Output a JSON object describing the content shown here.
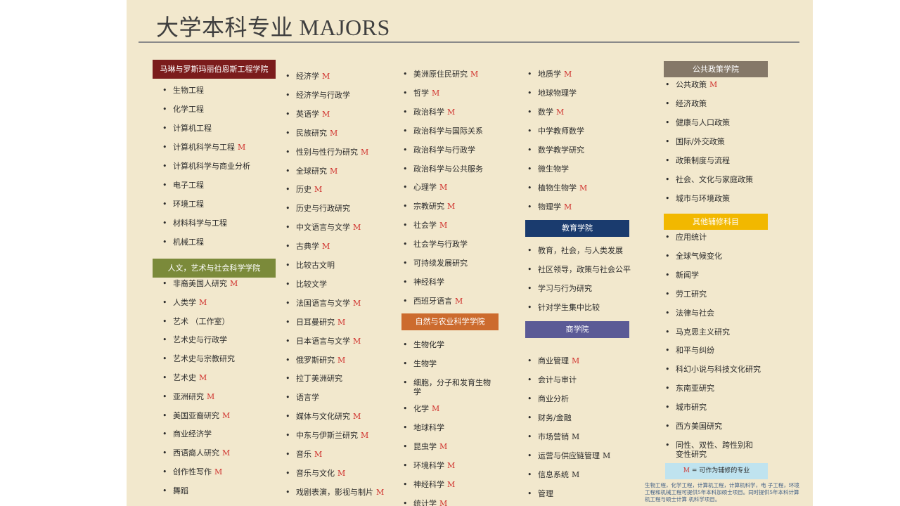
{
  "title": "大学本科专业 MAJORS",
  "m_marker": "M",
  "legend": {
    "marker": "M",
    "text": "= 可作为辅修的专业"
  },
  "note": "生物工程，化学工程，计算机工程，计算机科学，电 子工程，环境工程和机械工程可提供5年本科加硕士项目。同时提供5年本科计算机工程与硕士计算 机科学项目。",
  "sections": {
    "engineering": {
      "header": "马琳与罗斯玛丽伯恩斯工程学院",
      "color": "#7b1c1c",
      "items": [
        {
          "label": "生物工程",
          "m": false
        },
        {
          "label": "化学工程",
          "m": false
        },
        {
          "label": "计算机工程",
          "m": false
        },
        {
          "label": "计算机科学与工程",
          "m": true
        },
        {
          "label": "计算机科学与商业分析",
          "m": false
        },
        {
          "label": "电子工程",
          "m": false
        },
        {
          "label": "环境工程",
          "m": false
        },
        {
          "label": "材料科学与工程",
          "m": false
        },
        {
          "label": "机械工程",
          "m": false
        }
      ]
    },
    "humanities": {
      "header": "人文，艺术与社会科学学院",
      "color": "#7b8a3a",
      "items": [
        {
          "label": "非裔美国人研究",
          "m": true
        },
        {
          "label": "人类学",
          "m": true
        },
        {
          "label": "艺术 （工作室）",
          "m": false
        },
        {
          "label": "艺术史与行政学",
          "m": false
        },
        {
          "label": "艺术史与宗教研究",
          "m": false
        },
        {
          "label": "艺术史",
          "m": true
        },
        {
          "label": "亚洲研究",
          "m": true
        },
        {
          "label": "美国亚裔研究",
          "m": true
        },
        {
          "label": "商业经济学",
          "m": false
        },
        {
          "label": "西语裔人研究",
          "m": true
        },
        {
          "label": "创作性写作",
          "m": true
        },
        {
          "label": "舞蹈",
          "m": false
        }
      ]
    },
    "column2": {
      "items": [
        {
          "label": "经济学",
          "m": true
        },
        {
          "label": "经济学与行政学",
          "m": false
        },
        {
          "label": "英语学",
          "m": true
        },
        {
          "label": "民族研究",
          "m": true
        },
        {
          "label": "性别与性行为研究",
          "m": true
        },
        {
          "label": "全球研究",
          "m": true
        },
        {
          "label": "历史",
          "m": true
        },
        {
          "label": "历史与行政研究",
          "m": false
        },
        {
          "label": "中文语言与文学",
          "m": true
        },
        {
          "label": "古典学",
          "m": true
        },
        {
          "label": "比较古文明",
          "m": false
        },
        {
          "label": "比较文学",
          "m": false
        },
        {
          "label": "法国语言与文学",
          "m": true
        },
        {
          "label": "日耳曼研究",
          "m": true
        },
        {
          "label": "日本语言与文学",
          "m": true
        },
        {
          "label": "俄罗斯研究",
          "m": true
        },
        {
          "label": "拉丁美洲研究",
          "m": false
        },
        {
          "label": "语言学",
          "m": false
        },
        {
          "label": "媒体与文化研究",
          "m": true
        },
        {
          "label": "中东与伊斯兰研究",
          "m": true
        },
        {
          "label": "音乐",
          "m": true
        },
        {
          "label": "音乐与文化",
          "m": true
        },
        {
          "label": "戏剧表演，影视与制片",
          "m": true
        }
      ]
    },
    "column3": {
      "items": [
        {
          "label": "美洲原住民研究",
          "m": true
        },
        {
          "label": "哲学",
          "m": true
        },
        {
          "label": "政治科学",
          "m": true
        },
        {
          "label": "政治科学与国际关系",
          "m": false
        },
        {
          "label": "政治科学与行政学",
          "m": false
        },
        {
          "label": "政治科学与公共服务",
          "m": false
        },
        {
          "label": "心理学",
          "m": true
        },
        {
          "label": "宗教研究",
          "m": true
        },
        {
          "label": "社会学",
          "m": true
        },
        {
          "label": "社会学与行政学",
          "m": false
        },
        {
          "label": "可持续发展研究",
          "m": false
        },
        {
          "label": "神经科学",
          "m": false
        },
        {
          "label": "西班牙语言",
          "m": true
        }
      ]
    },
    "natural": {
      "header": "自然与农业科学学院",
      "color": "#cc6b2e",
      "items": [
        {
          "label": "生物化学",
          "m": false
        },
        {
          "label": "生物学",
          "m": false
        },
        {
          "label": "细胞，分子和发育生物学",
          "m": false
        },
        {
          "label": "化学",
          "m": true
        },
        {
          "label": "地球科学",
          "m": false
        },
        {
          "label": "昆虫学",
          "m": true
        },
        {
          "label": "环境科学",
          "m": true
        },
        {
          "label": "神经科学",
          "m": true
        },
        {
          "label": "统计学",
          "m": true
        }
      ]
    },
    "column4": {
      "items": [
        {
          "label": "地质学",
          "m": true
        },
        {
          "label": "地球物理学",
          "m": false
        },
        {
          "label": "数学",
          "m": true
        },
        {
          "label": "中学教师数学",
          "m": false
        },
        {
          "label": "数学教学研究",
          "m": false
        },
        {
          "label": "微生物学",
          "m": false
        },
        {
          "label": "植物生物学",
          "m": true
        },
        {
          "label": "物理学",
          "m": true
        }
      ]
    },
    "education": {
      "header": "教育学院",
      "color": "#1a3b6e",
      "items": [
        {
          "label": "教育，社会，与人类发展",
          "m": false
        },
        {
          "label": "社区领导，政策与社会公平",
          "m": false
        },
        {
          "label": "学习与行为研究",
          "m": false
        },
        {
          "label": "针对学生集中比较",
          "m": false
        }
      ]
    },
    "business": {
      "header": "商学院",
      "color": "#5b5a96",
      "items": [
        {
          "label": "商业管理",
          "m": true
        },
        {
          "label": "会计与审计",
          "m": false
        },
        {
          "label": "商业分析",
          "m": false
        },
        {
          "label": "财务/金融",
          "m": false
        },
        {
          "label": "市场营销",
          "m": true,
          "dark": true
        },
        {
          "label": "运营与供应链管理",
          "m": true,
          "dark": true
        },
        {
          "label": "信息系统",
          "m": true,
          "dark": true
        },
        {
          "label": "管理",
          "m": false
        }
      ]
    },
    "policy": {
      "header": "公共政策学院",
      "color": "#857868",
      "items": [
        {
          "label": "公共政策",
          "m": true
        },
        {
          "label": "经济政策",
          "m": false
        },
        {
          "label": "健康与人口政策",
          "m": false
        },
        {
          "label": "国际/外交政策",
          "m": false
        },
        {
          "label": "政策制度与流程",
          "m": false
        },
        {
          "label": "社会、文化与家庭政策",
          "m": false
        },
        {
          "label": "城市与环境政策",
          "m": false
        }
      ]
    },
    "minors": {
      "header": "其他辅修科目",
      "color": "#f2b800",
      "items": [
        {
          "label": "应用统计",
          "m": false
        },
        {
          "label": "全球气候变化",
          "m": false
        },
        {
          "label": "新闻学",
          "m": false
        },
        {
          "label": "劳工研究",
          "m": false
        },
        {
          "label": "法律与社会",
          "m": false
        },
        {
          "label": "马克思主义研究",
          "m": false
        },
        {
          "label": "和平与纠纷",
          "m": false
        },
        {
          "label": "科幻小说与科技文化研究",
          "m": false
        },
        {
          "label": "东南亚研究",
          "m": false
        },
        {
          "label": "城市研究",
          "m": false
        },
        {
          "label": "西方美国研究",
          "m": false
        },
        {
          "label": "同性、双性、跨性别和变性研究",
          "m": false
        }
      ]
    }
  }
}
